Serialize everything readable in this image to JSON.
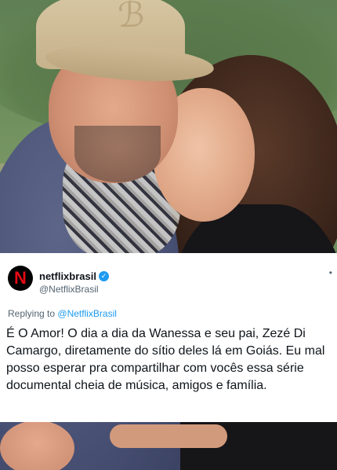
{
  "tweet": {
    "display_name": "netflixbrasil",
    "handle": "@NetflixBrasil",
    "avatar_letter": "N",
    "verified_icon": "✓",
    "more_icon": "•",
    "reply_prefix": "Replying to",
    "reply_to": "@NetflixBrasil",
    "text": "É O Amor! O dia a dia da Wanessa e seu pai, Zezé Di Camargo, diretamente do sítio deles lá em Goiás. Eu mal posso esperar pra compartilhar com vocês essa série documental cheia de música, amigos e família."
  },
  "photo": {
    "cap_logo": "ℬ"
  },
  "colors": {
    "accent_blue": "#1d9bf0",
    "netflix_red": "#e50914",
    "text_primary": "#0f1419",
    "text_secondary": "#536471"
  }
}
